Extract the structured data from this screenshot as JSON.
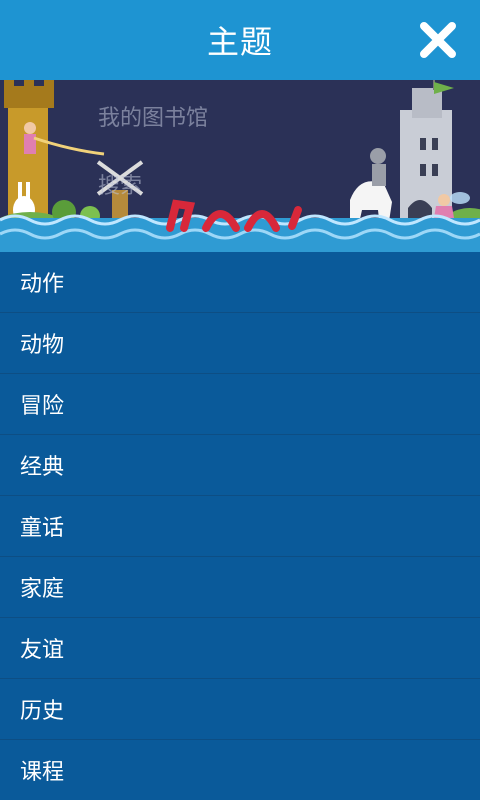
{
  "header": {
    "title": "主题",
    "close_icon": "close-icon"
  },
  "banner": {
    "library_label": "我的图书馆",
    "search_label": "搜索"
  },
  "menu": {
    "items": [
      {
        "label": "动作"
      },
      {
        "label": "动物"
      },
      {
        "label": "冒险"
      },
      {
        "label": "经典"
      },
      {
        "label": "童话"
      },
      {
        "label": "家庭"
      },
      {
        "label": "友谊"
      },
      {
        "label": "历史"
      },
      {
        "label": "课程"
      }
    ]
  },
  "colors": {
    "header_bg": "#1e94d2",
    "menu_bg": "#0a5a9a",
    "banner_bg": "#2b3157"
  }
}
